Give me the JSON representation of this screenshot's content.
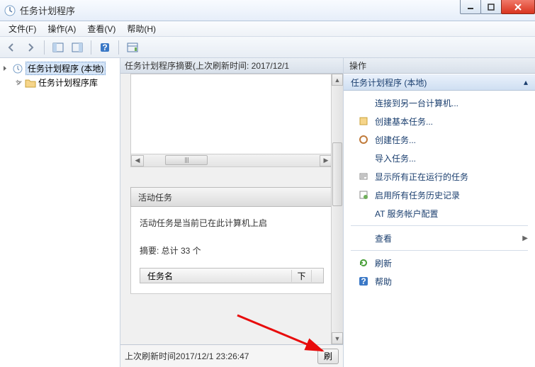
{
  "window": {
    "title": "任务计划程序"
  },
  "menu": {
    "file": "文件(F)",
    "action": "操作(A)",
    "view": "查看(V)",
    "help": "帮助(H)"
  },
  "tree": {
    "root": "任务计划程序 (本地)",
    "library": "任务计划程序库"
  },
  "summary": {
    "heading": "任务计划程序摘要(上次刷新时间: 2017/12/1",
    "active_tasks_header": "活动任务",
    "active_tasks_desc": "活动任务是当前已在此计算机上启",
    "active_tasks_count_label": "摘要: 总计 33 个",
    "col_taskname": "任务名",
    "col_next": "下",
    "status_prefix": "上次刷新时间",
    "status_time": "2017/12/1 23:26:47",
    "refresh_btn": "刷"
  },
  "actions": {
    "heading": "操作",
    "subheading": "任务计划程序 (本地)",
    "connect": "连接到另一台计算机...",
    "create_basic": "创建基本任务...",
    "create_task": "创建任务...",
    "import_task": "导入任务...",
    "show_running": "显示所有正在运行的任务",
    "enable_history": "启用所有任务历史记录",
    "at_service": "AT 服务帐户配置",
    "view": "查看",
    "refresh": "刷新",
    "help": "帮助"
  }
}
